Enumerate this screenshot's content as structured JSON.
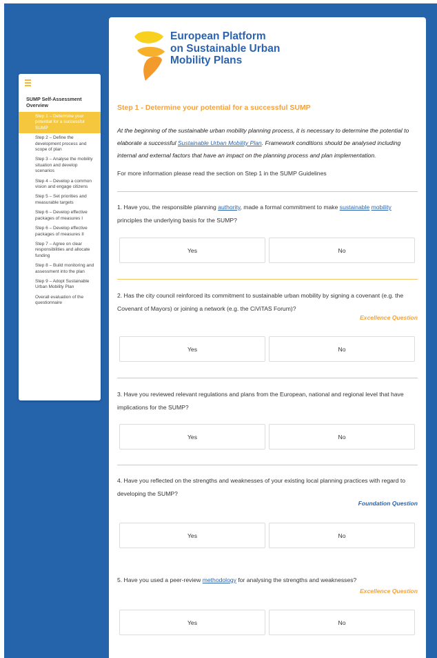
{
  "logo": {
    "line1": "European Platform",
    "line2": "on Sustainable Urban",
    "line3": "Mobility Plans"
  },
  "sidebar": {
    "menu_icon": "hamburger-icon",
    "title": "SUMP Self-Assessment Overview",
    "items": [
      {
        "label": "Step 1 – Determine your potential for a successful SUMP",
        "active": true
      },
      {
        "label": "Step 2 – Define the development process and scope of plan"
      },
      {
        "label": "Step 3 – Analyse the mobility situation and develop scenarios"
      },
      {
        "label": "Step 4 – Develop a common vision and engage citizens"
      },
      {
        "label": "Step 5 – Set priorities and measurable targets"
      },
      {
        "label": "Step 6 – Develop effective packages of measures I"
      },
      {
        "label": "Step 6 – Develop effective packages of measures II"
      },
      {
        "label": "Step 7 – Agree on clear responsibilities and allocate funding"
      },
      {
        "label": "Step 8 – Build monitoring and assessment into the plan"
      },
      {
        "label": "Step 9 – Adopt Sustainable Urban Mobility Plan"
      },
      {
        "label": "Overall evaluation of the questionnaire"
      }
    ]
  },
  "step": {
    "title": "Step 1 - Determine your potential for a successful SUMP",
    "intro_part1": "At the beginning of the sustainable urban mobility planning process, it is necessary to determine the potential to elaborate a successful ",
    "intro_link": "Sustainable Urban Mobility Plan",
    "intro_part2": ". Framework conditions should be analysed including internal and external factors that have an impact on the planning process and plan implementation.",
    "more_info": "For more information please read the section on Step 1 in the SUMP Guidelines"
  },
  "answers": {
    "yes": "Yes",
    "no": "No"
  },
  "questions": {
    "q1": {
      "t1": "1. Have you, the responsible planning ",
      "l1": "authority",
      "t2": ", made a formal commitment to make ",
      "l2": "sustainable",
      "t3": " ",
      "l3": "mobility",
      "t4": " principles the underlying basis for the SUMP?"
    },
    "q2": {
      "text": "2. Has the city council reinforced its commitment to sustainable urban mobility by signing a covenant (e.g. the Covenant of Mayors) or joining a network (e.g. the CiViTAS Forum)?",
      "tag": "Excellence Question"
    },
    "q3": {
      "text": "3. Have you reviewed relevant regulations and plans from the European, national and regional level that have implications for the SUMP?"
    },
    "q4": {
      "text": "4. Have you reflected on the strengths and weaknesses of your existing local planning practices with regard to developing the SUMP?",
      "tag": "Foundation Question"
    },
    "q5": {
      "t1": "5. Have you used a peer-review ",
      "l1": "methodology",
      "t2": " for analysing the strengths and weaknesses?",
      "tag": "Excellence Question"
    }
  }
}
